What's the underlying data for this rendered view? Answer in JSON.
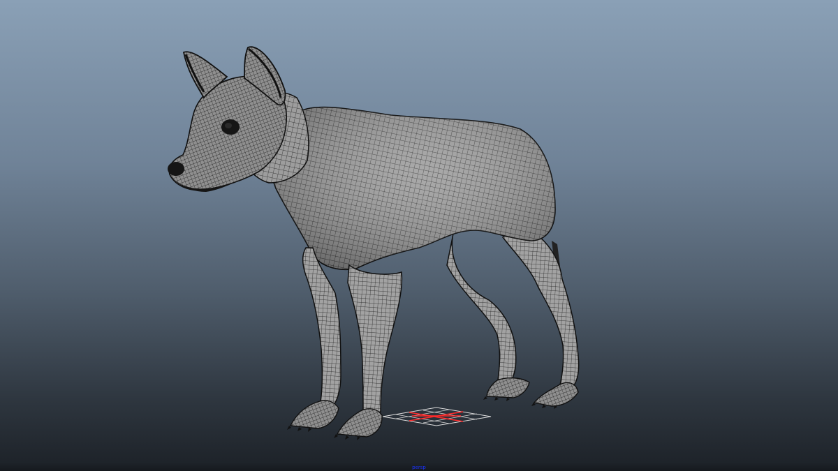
{
  "viewport": {
    "camera_label": "persp",
    "background_top": "#8aa0b6",
    "background_bottom": "#1c2127"
  },
  "model": {
    "name": "dog-wireframe-mesh",
    "surface_color": "#9c9c9c",
    "wire_color": "#1a1a1a"
  },
  "grid": {
    "axis_color": "#ff2a2a",
    "line_color": "#d8d8d8"
  }
}
